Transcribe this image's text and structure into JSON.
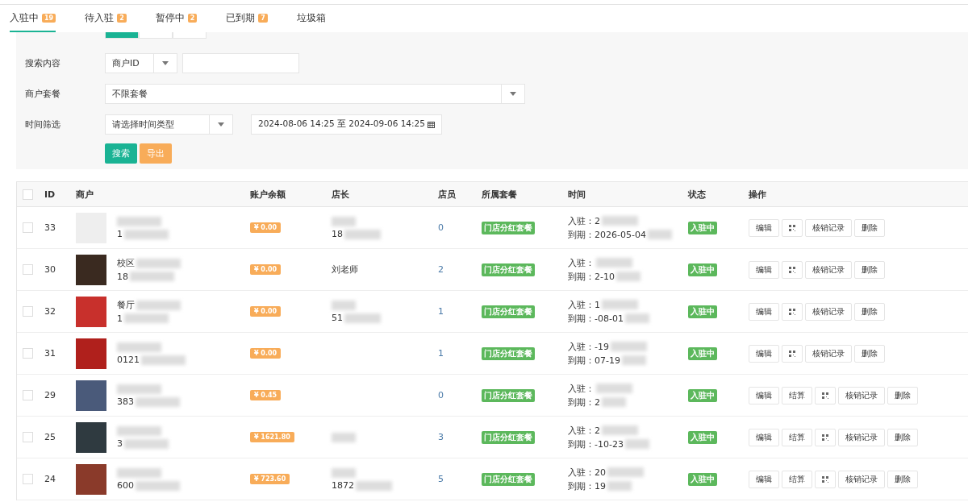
{
  "tabs": [
    {
      "label": "入驻中",
      "count": "19",
      "selected": true
    },
    {
      "label": "待入驻",
      "count": "2",
      "selected": false
    },
    {
      "label": "暂停中",
      "count": "2",
      "selected": false
    },
    {
      "label": "已到期",
      "count": "7",
      "selected": false
    },
    {
      "label": "垃圾箱",
      "selected": false
    }
  ],
  "filters": {
    "segments": [
      {
        "selected": true
      },
      {
        "selected": false
      },
      {
        "selected": false
      }
    ],
    "search": {
      "label": "搜索内容",
      "select": "商户ID"
    },
    "package": {
      "label": "商户套餐",
      "select": "不限套餐"
    },
    "time": {
      "label": "时间筛选",
      "select": "请选择时间类型",
      "range": "2024-08-06 14:25 至 2024-09-06 14:25"
    },
    "buttons": [
      {
        "label": "搜索",
        "kind": "primary"
      },
      {
        "label": "导出",
        "kind": "warning"
      }
    ]
  },
  "table": {
    "all_checked": false,
    "columns": [
      "ID",
      "商户",
      "账户余额",
      "店长",
      "店员",
      "所属套餐",
      "时间",
      "状态",
      "操作"
    ],
    "rows": [
      {
        "checked": false,
        "id": "33",
        "name": "",
        "phone": "1",
        "balance": "¥ 0.00",
        "manager": "",
        "manager_phone": "18",
        "staff": "0",
        "package": "门店分红套餐",
        "join": "入驻：2",
        "expire": "到期：2026-05-04",
        "status": "入驻中",
        "actions": [
          {
            "kind": "text",
            "label": "编辑"
          },
          {
            "kind": "qr"
          },
          {
            "kind": "text",
            "label": "核销记录"
          },
          {
            "kind": "text",
            "label": "删除"
          }
        ]
      },
      {
        "checked": false,
        "id": "30",
        "name": "校区",
        "phone": "18",
        "balance": "¥ 0.00",
        "manager": "刘老师",
        "manager_phone": "",
        "staff": "2",
        "package": "门店分红套餐",
        "join": "入驻：",
        "expire": "到期：2-10",
        "status": "入驻中",
        "actions": [
          {
            "kind": "text",
            "label": "编辑"
          },
          {
            "kind": "qr"
          },
          {
            "kind": "text",
            "label": "核销记录"
          },
          {
            "kind": "text",
            "label": "删除"
          }
        ]
      },
      {
        "checked": false,
        "id": "32",
        "name": "餐厅",
        "phone": "1",
        "balance": "¥ 0.00",
        "manager": "",
        "manager_phone": "51",
        "staff": "1",
        "package": "门店分红套餐",
        "join": "入驻：1",
        "expire": "到期：-08-01",
        "status": "入驻中",
        "actions": [
          {
            "kind": "text",
            "label": "编辑"
          },
          {
            "kind": "qr"
          },
          {
            "kind": "text",
            "label": "核销记录"
          },
          {
            "kind": "text",
            "label": "删除"
          }
        ]
      },
      {
        "checked": false,
        "id": "31",
        "name": "",
        "phone": "0121",
        "balance": "¥ 0.00",
        "manager": "",
        "manager_phone": "",
        "staff": "1",
        "package": "门店分红套餐",
        "join": "入驻：-19",
        "expire": "到期：07-19",
        "status": "入驻中",
        "actions": [
          {
            "kind": "text",
            "label": "编辑"
          },
          {
            "kind": "qr"
          },
          {
            "kind": "text",
            "label": "核销记录"
          },
          {
            "kind": "text",
            "label": "删除"
          }
        ]
      },
      {
        "checked": false,
        "id": "29",
        "name": "",
        "phone": "383",
        "balance": "¥ 0.45",
        "manager": "",
        "manager_phone": "",
        "staff": "0",
        "package": "门店分红套餐",
        "join": "入驻：",
        "expire": "到期：2",
        "status": "入驻中",
        "actions": [
          {
            "kind": "text",
            "label": "编辑"
          },
          {
            "kind": "text",
            "label": "结算"
          },
          {
            "kind": "qr"
          },
          {
            "kind": "text",
            "label": "核销记录"
          },
          {
            "kind": "text",
            "label": "删除"
          }
        ]
      },
      {
        "checked": false,
        "id": "25",
        "name": "",
        "phone": "3",
        "balance": "¥ 1621.80",
        "manager": "",
        "manager_phone": "",
        "staff": "3",
        "package": "门店分红套餐",
        "join": "入驻：2",
        "expire": "到期：-10-23",
        "status": "入驻中",
        "actions": [
          {
            "kind": "text",
            "label": "编辑"
          },
          {
            "kind": "text",
            "label": "结算"
          },
          {
            "kind": "qr"
          },
          {
            "kind": "text",
            "label": "核销记录"
          },
          {
            "kind": "text",
            "label": "删除"
          }
        ]
      },
      {
        "checked": false,
        "id": "24",
        "name": "",
        "phone": "600",
        "balance": "¥ 723.60",
        "manager": "",
        "manager_phone": "1872",
        "staff": "5",
        "package": "门店分红套餐",
        "join": "入驻：20",
        "expire": "到期：19",
        "status": "入驻中",
        "actions": [
          {
            "kind": "text",
            "label": "编辑"
          },
          {
            "kind": "text",
            "label": "结算"
          },
          {
            "kind": "qr"
          },
          {
            "kind": "text",
            "label": "核销记录"
          },
          {
            "kind": "text",
            "label": "删除"
          }
        ]
      }
    ]
  }
}
